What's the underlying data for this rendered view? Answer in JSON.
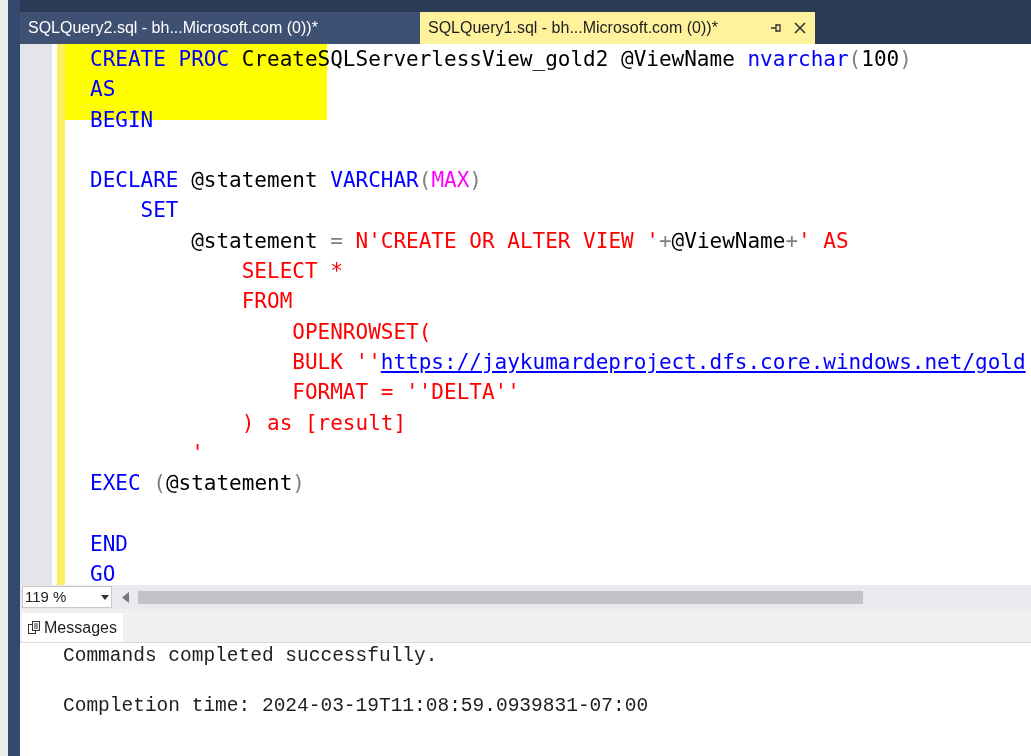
{
  "tabs": [
    {
      "label": "SQLQuery2.sql - bh...Microsoft.com (0))*",
      "selected": false
    },
    {
      "label": "SQLQuery1.sql - bh...Microsoft.com (0))*",
      "selected": true
    }
  ],
  "editor": {
    "lines": [
      {
        "kind": "code",
        "tokens": [
          {
            "kind": "keyword",
            "text": "CREATE PROC "
          },
          {
            "kind": "ident",
            "text": "CreateSQLServerlessView_gold2 @ViewName "
          },
          {
            "kind": "keyword",
            "text": "nvarchar"
          },
          {
            "kind": "op",
            "text": "("
          },
          {
            "kind": "ident",
            "text": "100"
          },
          {
            "kind": "op",
            "text": ")"
          }
        ]
      },
      {
        "kind": "code",
        "tokens": [
          {
            "kind": "keyword",
            "text": "AS"
          }
        ]
      },
      {
        "kind": "code",
        "tokens": [
          {
            "kind": "keyword",
            "text": "BEGIN"
          }
        ]
      },
      {
        "kind": "blank"
      },
      {
        "kind": "code",
        "tokens": [
          {
            "kind": "keyword",
            "text": "DECLARE "
          },
          {
            "kind": "ident",
            "text": "@statement "
          },
          {
            "kind": "keyword",
            "text": "VARCHAR"
          },
          {
            "kind": "op",
            "text": "("
          },
          {
            "kind": "func",
            "text": "MAX"
          },
          {
            "kind": "op",
            "text": ")"
          }
        ]
      },
      {
        "kind": "code",
        "tokens": [
          {
            "kind": "keyword",
            "text": "    SET"
          }
        ]
      },
      {
        "kind": "code",
        "tokens": [
          {
            "kind": "ident",
            "text": "        @statement "
          },
          {
            "kind": "op",
            "text": "= "
          },
          {
            "kind": "string",
            "text": "N'CREATE OR ALTER VIEW '"
          },
          {
            "kind": "op",
            "text": "+"
          },
          {
            "kind": "ident",
            "text": "@ViewName"
          },
          {
            "kind": "op",
            "text": "+"
          },
          {
            "kind": "string",
            "text": "' AS"
          }
        ]
      },
      {
        "kind": "code",
        "tokens": [
          {
            "kind": "string",
            "text": "            SELECT *"
          }
        ]
      },
      {
        "kind": "code",
        "tokens": [
          {
            "kind": "string",
            "text": "            FROM"
          }
        ]
      },
      {
        "kind": "code",
        "tokens": [
          {
            "kind": "string",
            "text": "                OPENROWSET("
          }
        ]
      },
      {
        "kind": "code",
        "tokens": [
          {
            "kind": "string",
            "text": "                BULK ''"
          },
          {
            "kind": "link",
            "text": "https://jaykumardeproject.dfs.core.windows.net/gold"
          }
        ]
      },
      {
        "kind": "code",
        "tokens": [
          {
            "kind": "string",
            "text": "                FORMAT = ''DELTA''"
          }
        ]
      },
      {
        "kind": "code",
        "tokens": [
          {
            "kind": "string",
            "text": "            ) as [result]"
          }
        ]
      },
      {
        "kind": "code",
        "tokens": [
          {
            "kind": "string",
            "text": "        '"
          }
        ]
      },
      {
        "kind": "code",
        "tokens": [
          {
            "kind": "keyword",
            "text": "EXEC "
          },
          {
            "kind": "op",
            "text": "("
          },
          {
            "kind": "ident",
            "text": "@statement"
          },
          {
            "kind": "op",
            "text": ")"
          }
        ]
      },
      {
        "kind": "blank"
      },
      {
        "kind": "code",
        "tokens": [
          {
            "kind": "keyword",
            "text": "END"
          }
        ]
      },
      {
        "kind": "code",
        "tokens": [
          {
            "kind": "keyword",
            "text": "GO"
          }
        ]
      }
    ]
  },
  "zoom": "119 %",
  "results": {
    "tab": "Messages",
    "lines": [
      {
        "kind": "text",
        "text": "Commands completed successfully."
      },
      {
        "kind": "blank"
      },
      {
        "kind": "text",
        "text": "Completion time: 2024-03-19T11:08:59.0939831-07:00"
      }
    ]
  }
}
